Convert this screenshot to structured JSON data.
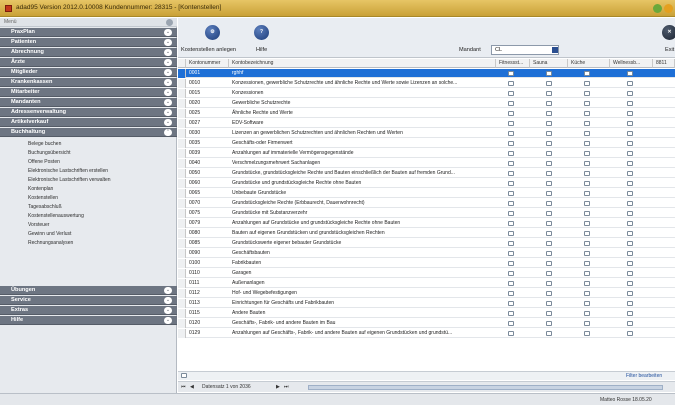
{
  "window": {
    "title": "adad95  Version 2012.0.10008  Kundennummer: 28315 - [Kontenstellen]"
  },
  "sidebar": {
    "header": "Menü",
    "sections": [
      {
        "label": "PraxPlan"
      },
      {
        "label": "Patienten"
      },
      {
        "label": "Abrechnung"
      },
      {
        "label": "Ärzte"
      },
      {
        "label": "Mitglieder"
      },
      {
        "label": "Krankenkassen"
      },
      {
        "label": "Mitarbeiter"
      },
      {
        "label": "Mandanten"
      },
      {
        "label": "Adressenverwaltung"
      },
      {
        "label": "Artikelverkauf"
      },
      {
        "label": "Buchhaltung"
      }
    ],
    "buchhaltung_items": [
      "Belege buchen",
      "Buchungsübersicht",
      "Offene Posten",
      "Elektronische Lastschriften erstellen",
      "Elektronische Lastschriften verwalten",
      "Kontenplan",
      "Kostenstellen",
      "Tagesabschluß",
      "Kostenstellenauswertung",
      "Vorsteuer",
      "Gewinn und Verlust",
      "Rechnungsanalysen"
    ],
    "sections_bottom": [
      {
        "label": "Übungen"
      },
      {
        "label": "Service"
      },
      {
        "label": "Extras"
      },
      {
        "label": "Hilfe"
      }
    ]
  },
  "toolbar": {
    "btn_add_label": "Kostenstellen anlegen",
    "btn_help_label": "Hilfe",
    "mandant_label": "Mandant",
    "mandant_value": "CL",
    "exit_label": "Exit"
  },
  "grid": {
    "columns": [
      "Kontonummer",
      "Kontobezeichnung",
      "Fitnessst...",
      "Sauna",
      "Küche",
      "Wellnessb...",
      "8811"
    ],
    "rows": [
      [
        "0001",
        "rghhf"
      ],
      [
        "0010",
        "Konzessionen, gewerbliche Schutzrechte und ähnliche Rechte und Werte sowie Lizenzen an solche..."
      ],
      [
        "0015",
        "Konzessionen"
      ],
      [
        "0020",
        "Gewerbliche Schutzrechte"
      ],
      [
        "0025",
        "Ähnliche Rechte und Werte"
      ],
      [
        "0027",
        "EDV-Software"
      ],
      [
        "0030",
        "Lizenzen an gewerblichen Schutzrechten und ähnlichen Rechten und Werten"
      ],
      [
        "0035",
        "Geschäfts-oder Firmenwert"
      ],
      [
        "0039",
        "Anzahlungen auf immaterielle Vermögensgegenstände"
      ],
      [
        "0040",
        "Verschmelzungsmehrwert Sachanlagen"
      ],
      [
        "0050",
        "Grundstücke, grundstücksgleiche Rechte und Bauten einschließlich der Bauten auf fremden Grund..."
      ],
      [
        "0060",
        "Grundstücke und grundstücksgleiche Rechte ohne Bauten"
      ],
      [
        "0065",
        "Unbebaute Grundstücke"
      ],
      [
        "0070",
        "Grundstücksgleiche Rechte (Erbbaurecht, Dauerwohnrecht)"
      ],
      [
        "0075",
        "Grundstücke mit Substanzverzehr"
      ],
      [
        "0079",
        "Anzahlungen auf Grundstücke und grundstücksgleiche Rechte ohne Bauten"
      ],
      [
        "0080",
        "Bauten auf eigenen Grundstücken und grundstücksgleichen Rechten"
      ],
      [
        "0085",
        "Grundstückswerte eigener bebauter Grundstücke"
      ],
      [
        "0090",
        "Geschäftsbauten"
      ],
      [
        "0100",
        "Fabrikbauten"
      ],
      [
        "0110",
        "Garagen"
      ],
      [
        "0111",
        "Außenanlagen"
      ],
      [
        "0112",
        "Hof- und Wegebefestigungen"
      ],
      [
        "0113",
        "Einrichtungen für Geschäfts und Fabrikbauten"
      ],
      [
        "0115",
        "Andere Bauten"
      ],
      [
        "0120",
        "Geschäfts-, Fabrik- und andere Bauten im Bau"
      ],
      [
        "0129",
        "Anzahlungen auf Geschäfts-, Fabrik- und andere Bauten auf eigenen Grundstücken und grundstü..."
      ]
    ]
  },
  "footer": {
    "filter_button": "Filter bearbeiten",
    "record_text": "Datensatz 1 von 2036"
  },
  "status": {
    "user": "Matteo Rosse  18.05.20"
  },
  "colors": {
    "selected_row": "#1e6fd6",
    "nav_section": "#6d7582",
    "title_bar": "#d6b24c"
  }
}
